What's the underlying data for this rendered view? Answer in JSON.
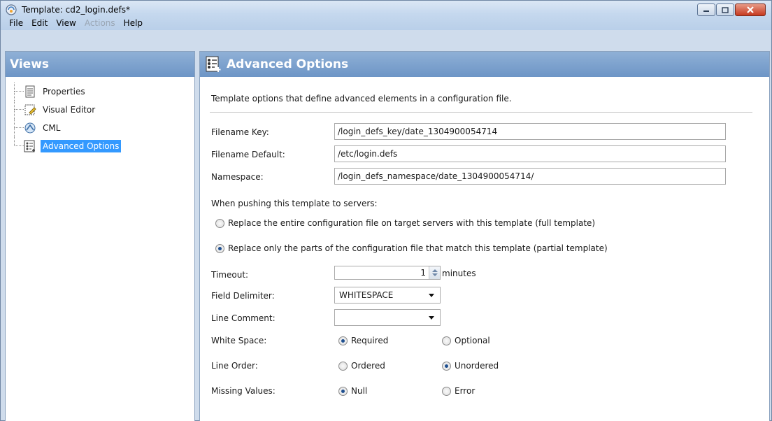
{
  "window": {
    "title": "Template: cd2_login.defs*",
    "icon": "template-icon"
  },
  "menu": [
    {
      "label": "File",
      "enabled": true
    },
    {
      "label": "Edit",
      "enabled": true
    },
    {
      "label": "View",
      "enabled": true
    },
    {
      "label": "Actions",
      "enabled": false
    },
    {
      "label": "Help",
      "enabled": true
    }
  ],
  "views": {
    "title": "Views",
    "items": [
      {
        "label": "Properties",
        "icon": "properties-icon",
        "selected": false
      },
      {
        "label": "Visual Editor",
        "icon": "visual-editor-icon",
        "selected": false
      },
      {
        "label": "CML",
        "icon": "cml-icon",
        "selected": false
      },
      {
        "label": "Advanced Options",
        "icon": "advanced-options-icon",
        "selected": true
      }
    ]
  },
  "advanced": {
    "title": "Advanced Options",
    "description": "Template options that define advanced elements in a configuration file.",
    "filename_key_label": "Filename Key:",
    "filename_key": "/login_defs_key/date_1304900054714",
    "filename_default_label": "Filename Default:",
    "filename_default": "/etc/login.defs",
    "namespace_label": "Namespace:",
    "namespace": "/login_defs_namespace/date_1304900054714/",
    "push_label": "When pushing this template to servers:",
    "push_options": [
      {
        "label": "Replace the entire configuration file on target servers with this template (full template)",
        "selected": false
      },
      {
        "label": "Replace only the parts of the configuration file that match this template (partial template)",
        "selected": true
      }
    ],
    "timeout_label": "Timeout:",
    "timeout_value": "1",
    "timeout_unit": "minutes",
    "field_delimiter_label": "Field Delimiter:",
    "field_delimiter": "WHITESPACE",
    "line_comment_label": "Line Comment:",
    "line_comment": "",
    "white_space_label": "White Space:",
    "white_space_options": [
      {
        "label": "Required",
        "selected": true
      },
      {
        "label": "Optional",
        "selected": false
      }
    ],
    "line_order_label": "Line Order:",
    "line_order_options": [
      {
        "label": "Ordered",
        "selected": false
      },
      {
        "label": "Unordered",
        "selected": true
      }
    ],
    "missing_values_label": "Missing Values:",
    "missing_values_options": [
      {
        "label": "Null",
        "selected": true
      },
      {
        "label": "Error",
        "selected": false
      }
    ]
  },
  "colors": {
    "header_gradient_top": "#8fb0d6",
    "header_gradient_bottom": "#6d95c6",
    "selection": "#3399ff",
    "close_button": "#c6391f"
  }
}
